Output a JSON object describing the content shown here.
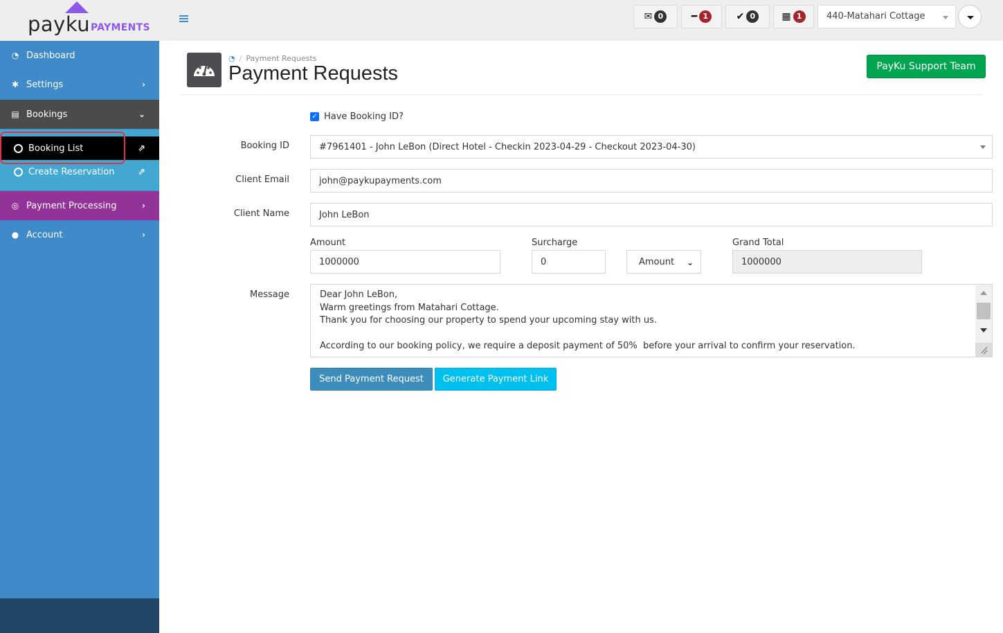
{
  "brand": {
    "name": "payku",
    "suffix": "PAYMENTS",
    "accent": "#8d5ae8"
  },
  "topbar": {
    "notifications": [
      {
        "icon": "envelope-open-icon",
        "glyph": "✉",
        "count": "0",
        "badge_color": "#333333"
      },
      {
        "icon": "minus-icon",
        "glyph": "━",
        "count": "1",
        "badge_color": "#a4262c"
      },
      {
        "icon": "check-icon",
        "glyph": "✔",
        "count": "0",
        "badge_color": "#333333"
      },
      {
        "icon": "calendar-icon",
        "glyph": "▦",
        "count": "1",
        "badge_color": "#a4262c"
      }
    ],
    "property_select": "440-Matahari Cottage"
  },
  "sidebar": {
    "items": [
      {
        "label": "Dashboard",
        "icon": "tachometer-icon",
        "glyph": "◔"
      },
      {
        "label": "Settings",
        "icon": "gear-icon",
        "glyph": "✱",
        "chevron": "›"
      },
      {
        "label": "Bookings",
        "icon": "list-alt-icon",
        "glyph": "▤",
        "chevron": "⌄"
      },
      {
        "label": "Payment Processing",
        "icon": "bullseye-icon",
        "glyph": "◎",
        "chevron": "›"
      },
      {
        "label": "Account",
        "icon": "user-icon",
        "glyph": "●",
        "chevron": "›"
      }
    ],
    "subitems": [
      {
        "label": "Booking List",
        "ext_glyph": "⇗"
      },
      {
        "label": "Create Reservation",
        "ext_glyph": "⇗"
      }
    ],
    "colors": {
      "main": "#3f8ac9",
      "active": "#4b4b4b",
      "submenu": "#42a8d1",
      "payment": "#93339a",
      "footer": "#214667"
    }
  },
  "page": {
    "breadcrumb": {
      "home_glyph": "◔",
      "separator": "/",
      "current": "Payment Requests"
    },
    "title": "Payment Requests",
    "support_button": "PayKu Support Team"
  },
  "form": {
    "have_booking_id": {
      "label": "Have Booking ID?",
      "checked": true,
      "check_glyph": "✓"
    },
    "booking_id": {
      "label": "Booking ID",
      "value": "#7961401 - John LeBon (Direct Hotel - Checkin 2023-04-29 - Checkout 2023-04-30)"
    },
    "client_email": {
      "label": "Client Email",
      "value": "john@paykupayments.com"
    },
    "client_name": {
      "label": "Client Name",
      "value": "John LeBon"
    },
    "amount": {
      "label": "Amount",
      "value": "1000000"
    },
    "surcharge": {
      "label": "Surcharge",
      "value": "0",
      "type_select": "Amount",
      "chevron": "⌄"
    },
    "grand_total": {
      "label": "Grand Total",
      "value": "1000000"
    },
    "message": {
      "label": "Message",
      "value": "Dear John LeBon,\nWarm greetings from Matahari Cottage.\nThank you for choosing our property to spend your upcoming stay with us.\n\nAccording to our booking policy, we require a deposit payment of 50%  before your arrival to confirm your reservation."
    },
    "buttons": {
      "send": "Send Payment Request",
      "generate": "Generate Payment Link"
    }
  }
}
